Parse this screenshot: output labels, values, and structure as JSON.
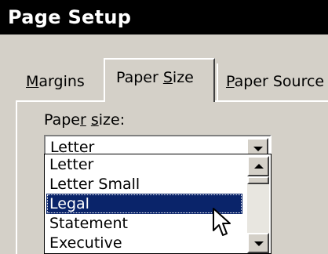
{
  "window": {
    "title": "Page Setup"
  },
  "tabs": [
    {
      "label_prefix": "",
      "label_mnemonic": "M",
      "label_suffix": "argins",
      "active": false
    },
    {
      "label_prefix": "Paper ",
      "label_mnemonic": "S",
      "label_suffix": "ize",
      "active": true
    },
    {
      "label_prefix": "",
      "label_mnemonic": "P",
      "label_suffix": "aper Source",
      "active": false
    }
  ],
  "paper_size": {
    "label_prefix": "Pape",
    "label_mnemonic": "r",
    "label_mid": " ",
    "label_mnemonic2": "s",
    "label_suffix": "ize:",
    "selected_value": "Letter",
    "options": [
      "Letter",
      "Letter Small",
      "Legal",
      "Statement",
      "Executive"
    ],
    "highlighted_option": "Legal"
  },
  "colors": {
    "selection": "#0a246a",
    "face": "#d4d0c8",
    "titlebar": "#000000"
  },
  "icons": {
    "combo_arrow": "chevron-down-icon",
    "scroll_up": "arrow-up-icon",
    "scroll_down": "arrow-down-icon",
    "cursor": "mouse-pointer-icon"
  }
}
